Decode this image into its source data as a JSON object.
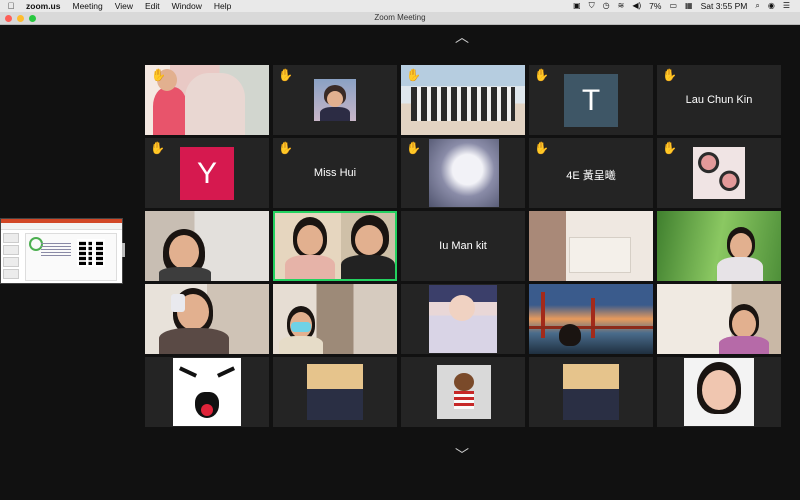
{
  "menubar": {
    "app_name": "zoom.us",
    "menus": [
      "Meeting",
      "View",
      "Edit",
      "Window",
      "Help"
    ],
    "battery": "7%",
    "clock": "Sat 3:55 PM"
  },
  "window": {
    "title": "Zoom Meeting"
  },
  "participants": {
    "lau_chun_kin": "Lau Chun Kin",
    "miss_hui": "Miss Hui",
    "ie_4e": "4E 黃呈曦",
    "iu_man_kit": "Iu Man kit",
    "avatar_t_letter": "T",
    "avatar_y_letter": "Y"
  },
  "colors": {
    "avatar_t": "#3e5666",
    "avatar_y": "#d6194f",
    "active_speaker": "#23d160",
    "hand": "#f4b400"
  },
  "icons": {
    "raised_hand": "✋",
    "chevron_up": "︿",
    "chevron_down": "﹀"
  }
}
